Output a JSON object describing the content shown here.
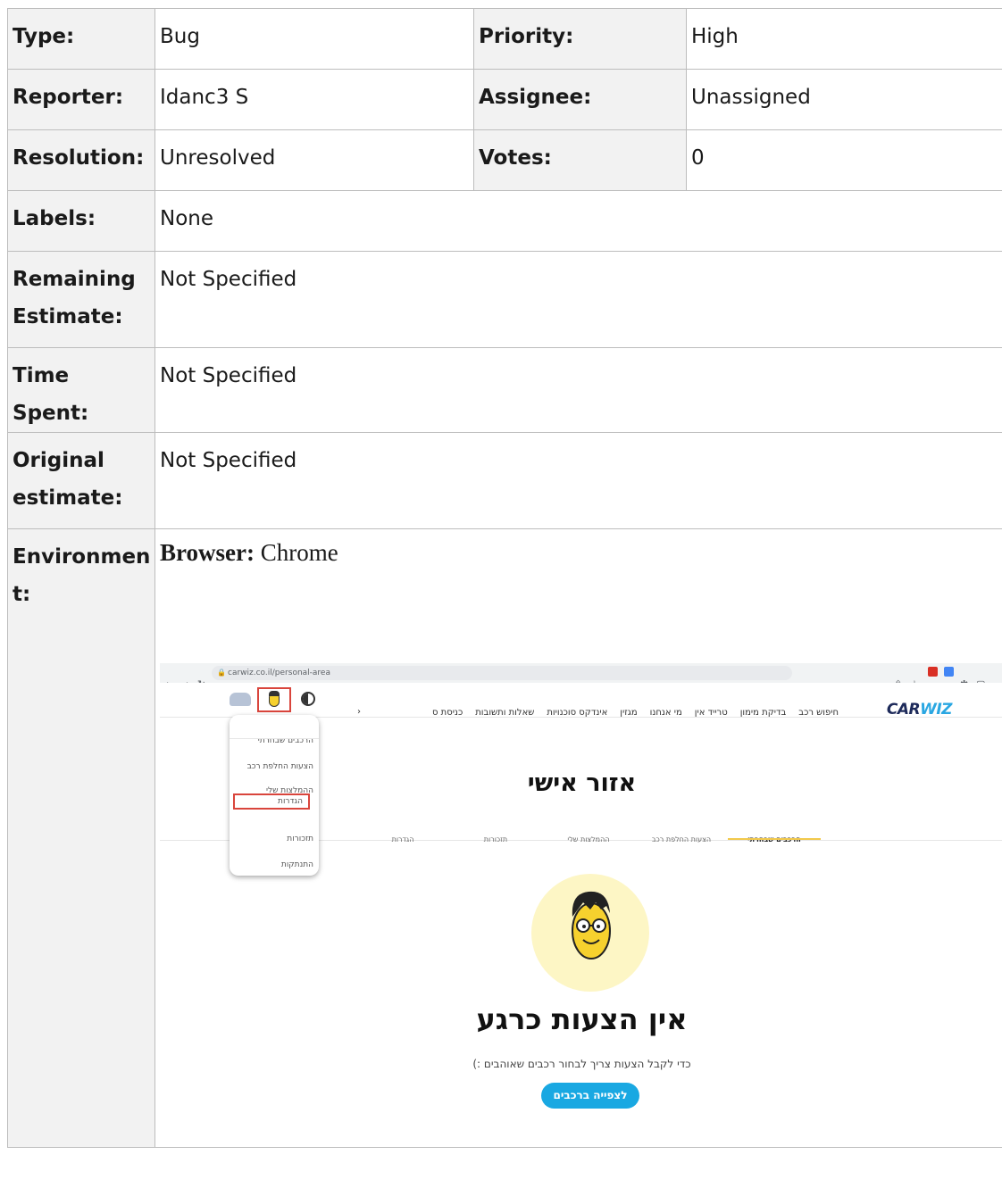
{
  "fields": {
    "type_label": "Type:",
    "type_value": "Bug",
    "priority_label": "Priority:",
    "priority_value": "High",
    "reporter_label": "Reporter:",
    "reporter_value": "Idanc3 S",
    "assignee_label": "Assignee:",
    "assignee_value": "Unassigned",
    "resolution_label": "Resolution:",
    "resolution_value": "Unresolved",
    "votes_label": "Votes:",
    "votes_value": "0",
    "labels_label": "Labels:",
    "labels_value": "None",
    "remaining_label_1": "Remaining",
    "remaining_label_2": "Estimate:",
    "remaining_value": "Not Specified",
    "timespent_label": "Time Spent:",
    "timespent_value": "Not Specified",
    "original_label_1": "Original",
    "original_label_2": "estimate:",
    "original_value": "Not Specified",
    "environment_label_1": "Environmen",
    "environment_label_2": "t:",
    "environment_browser_key": "Browser:",
    "environment_browser_value": "Chrome"
  },
  "screenshot": {
    "url": "carwiz.co.il/personal-area",
    "logo_a": "CAR",
    "logo_b": "WIZ",
    "nav": [
      "חיפוש רכב",
      "בדיקת מימון",
      "טרייד אין",
      "מי אנחנו",
      "מגזין",
      "אינדקס סוכנויות",
      "שאלות ותשובות",
      "כניסת ס"
    ],
    "nav_chevron": "›",
    "page_title": "אזור אישי",
    "tabs": [
      "הרכבים שבחרתי",
      "הצעות החלפת רכב",
      "ההמלצות שלי",
      "תזכורות",
      "הגדרות"
    ],
    "menu": [
      "הרכבים שבחרתי",
      "הצעות החלפת רכב",
      "ההמלצות שלי",
      "הגדרות",
      "תזכורות",
      "התנתקות"
    ],
    "empty_title": "אין הצעות כרגע",
    "empty_subtitle": "כדי לקבל הצעות צריך לבחור רכבים שאוהבים :)",
    "cta_label": "לצפייה ברכבים",
    "colors": {
      "brand_dark": "#1d2a5a",
      "brand_blue": "#2aa7e2",
      "highlight_red": "#d9453c",
      "tab_underline": "#f2c94c",
      "cta_bg": "#19a8e2"
    }
  }
}
